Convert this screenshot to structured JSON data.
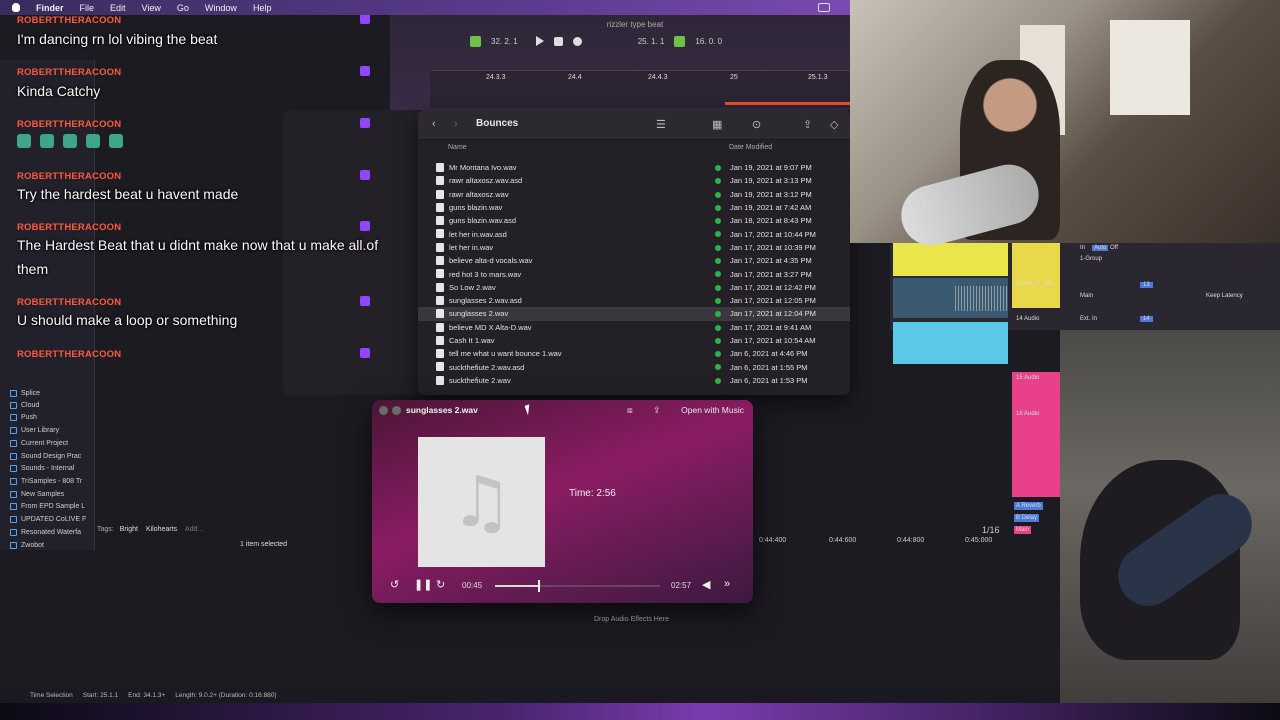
{
  "menubar": {
    "items": [
      "Finder",
      "File",
      "Edit",
      "View",
      "Go",
      "Window",
      "Help"
    ]
  },
  "daw": {
    "project_title": "rizzler type beat",
    "transport": {
      "position": "32. 2. 1",
      "loop_start": "25. 1. 1",
      "loop_length": "16. 0. 0"
    },
    "timeline_ticks": [
      "24.3.3",
      "24.4",
      "24.4.3",
      "25",
      "25.1.3"
    ],
    "bottom_ticks": [
      "0:44:400",
      "0:44:600",
      "0:44:800",
      "0:45:000"
    ],
    "quantize": "1/16",
    "drop_audio": "Drop Audio Effects Here",
    "tags_label": "Tags:",
    "tags": [
      "Bright",
      "Kilohearts",
      "Add..."
    ],
    "selection_count": "1 item selected",
    "status": {
      "label": "Time Selection",
      "start": "Start: 25.1.1",
      "end": "End: 34.1.3+",
      "length": "Length: 9.0.2+ (Duration: 0:16:880)"
    },
    "tracks": [
      "13 sm_rr_128",
      "14 Audio",
      "15 Audio",
      "16 Audio",
      "A Reverb",
      "B Delay",
      "Main"
    ],
    "mixer_labels": [
      "In",
      "Auto",
      "Off",
      "1-Group",
      "Main",
      "Keep Latency",
      "Ext. In",
      "13",
      "14"
    ]
  },
  "browser": {
    "items": [
      "Splice",
      "Cloud",
      "Push",
      "User Library",
      "Current Project",
      "Sound Design Prac",
      "Sounds - Internal",
      "TriSamples - 808 Tr",
      "New Samples",
      "From EPD Sample L",
      "UPDATED CoLIVE F",
      "Resonated Waterfa",
      "Zwobot"
    ]
  },
  "chat": {
    "messages": [
      {
        "user": "ROBERTTHERACOON",
        "text": "I'm dancing rn lol vibing the beat"
      },
      {
        "user": "ROBERTTHERACOON",
        "text": "Kinda Catchy"
      },
      {
        "user": "ROBERTTHERACOON",
        "text": ""
      },
      {
        "user": "ROBERTTHERACOON",
        "text": "Try the hardest beat u havent made"
      },
      {
        "user": "ROBERTTHERACOON",
        "text": "The Hardest Beat that u didnt make now that u make all.of them"
      },
      {
        "user": "ROBERTTHERACOON",
        "text": "U should make a loop or something"
      },
      {
        "user": "ROBERTTHERACOON",
        "text": ""
      }
    ]
  },
  "finder": {
    "title": "Bounces",
    "col_name": "Name",
    "col_date": "Date Modified",
    "files": [
      {
        "name": "Mr Montana Ivo.wav",
        "date": "Jan 19, 2021 at 9:07 PM"
      },
      {
        "name": "rawr altaxosz.wav.asd",
        "date": "Jan 19, 2021 at 3:13 PM"
      },
      {
        "name": "rawr altaxosz.wav",
        "date": "Jan 19, 2021 at 3:12 PM"
      },
      {
        "name": "guns blazin.wav",
        "date": "Jan 19, 2021 at 7:42 AM"
      },
      {
        "name": "guns blazin.wav.asd",
        "date": "Jan 18, 2021 at 8:43 PM"
      },
      {
        "name": "let her in.wav.asd",
        "date": "Jan 17, 2021 at 10:44 PM"
      },
      {
        "name": "let her in.wav",
        "date": "Jan 17, 2021 at 10:39 PM"
      },
      {
        "name": "believe alta-d vocals.wav",
        "date": "Jan 17, 2021 at 4:35 PM"
      },
      {
        "name": "red hot 3 to mars.wav",
        "date": "Jan 17, 2021 at 3:27 PM"
      },
      {
        "name": "So Low 2.wav",
        "date": "Jan 17, 2021 at 12:42 PM"
      },
      {
        "name": "sunglasses 2.wav.asd",
        "date": "Jan 17, 2021 at 12:05 PM"
      },
      {
        "name": "sunglasses 2.wav",
        "date": "Jan 17, 2021 at 12:04 PM"
      },
      {
        "name": "believe MD X Alta-D.wav",
        "date": "Jan 17, 2021 at 9:41 AM"
      },
      {
        "name": "Cash It 1.wav",
        "date": "Jan 17, 2021 at 10:54 AM"
      },
      {
        "name": "tell me what u want bounce 1.wav",
        "date": "Jan 6, 2021 at 4:46 PM"
      },
      {
        "name": "suckthefiute 2.wav.asd",
        "date": "Jan 6, 2021 at 1:55 PM"
      },
      {
        "name": "suckthefiute 2.wav",
        "date": "Jan 6, 2021 at 1:53 PM"
      }
    ],
    "selected_index": 11
  },
  "quicklook": {
    "title": "sunglasses 2.wav",
    "open_with": "Open with Music",
    "time_label": "Time: 2:56",
    "current": "00:45",
    "duration": "02:57",
    "progress": 0.26
  }
}
